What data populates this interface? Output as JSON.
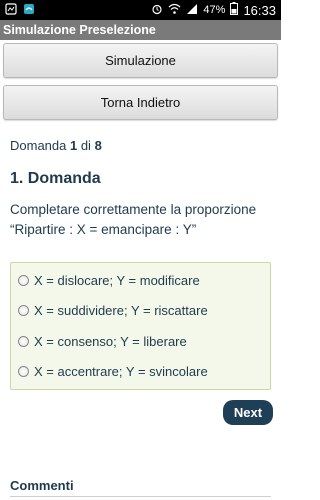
{
  "status_bar": {
    "battery": "47%",
    "time": "16:33"
  },
  "app_bar": {
    "title": "Simulazione Preselezione"
  },
  "buttons": {
    "simulation": "Simulazione",
    "back": "Torna Indietro",
    "next": "Next"
  },
  "question": {
    "count_prefix": "Domanda ",
    "current": "1",
    "count_mid": " di ",
    "total": "8",
    "title": "1. Domanda",
    "text": "Completare correttamente la proporzione “Ripartire : X = emancipare : Y”"
  },
  "answers": [
    "X = dislocare; Y = modificare",
    "X = suddividere; Y = riscattare",
    "X = consenso; Y = liberare",
    "X = accentrare; Y = svincolare"
  ],
  "comments": {
    "label": "Commenti"
  }
}
